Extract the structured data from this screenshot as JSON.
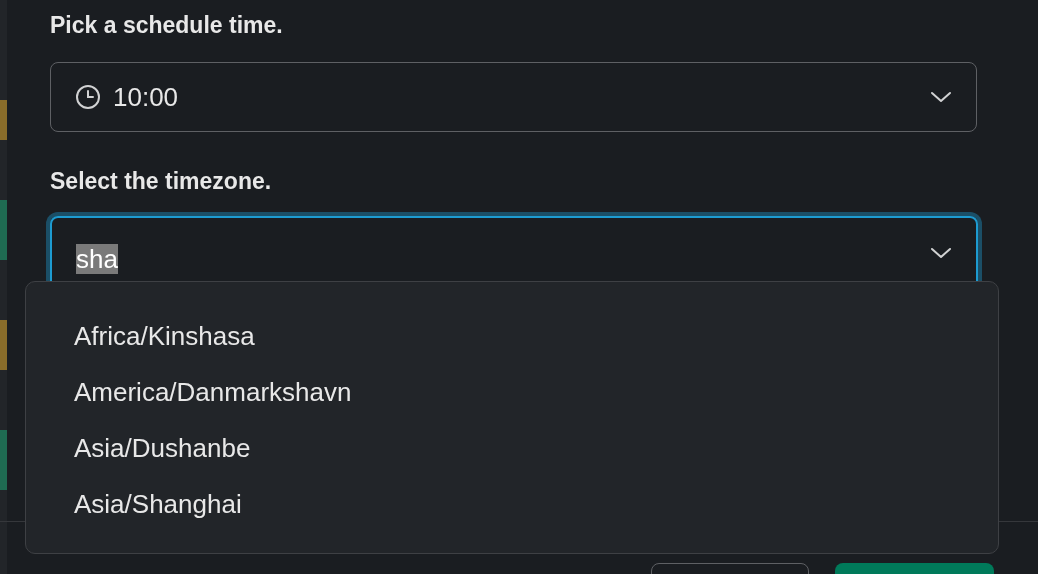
{
  "time_field": {
    "label": "Pick a schedule time.",
    "value": "10:00"
  },
  "timezone_field": {
    "label": "Select the timezone.",
    "value": "sha",
    "focused": true,
    "text_highlighted": true
  },
  "dropdown": {
    "options": [
      {
        "label": "Africa/Kinshasa"
      },
      {
        "label": "America/Danmarkshavn"
      },
      {
        "label": "Asia/Dushanbe"
      },
      {
        "label": "Asia/Shanghai"
      }
    ]
  }
}
